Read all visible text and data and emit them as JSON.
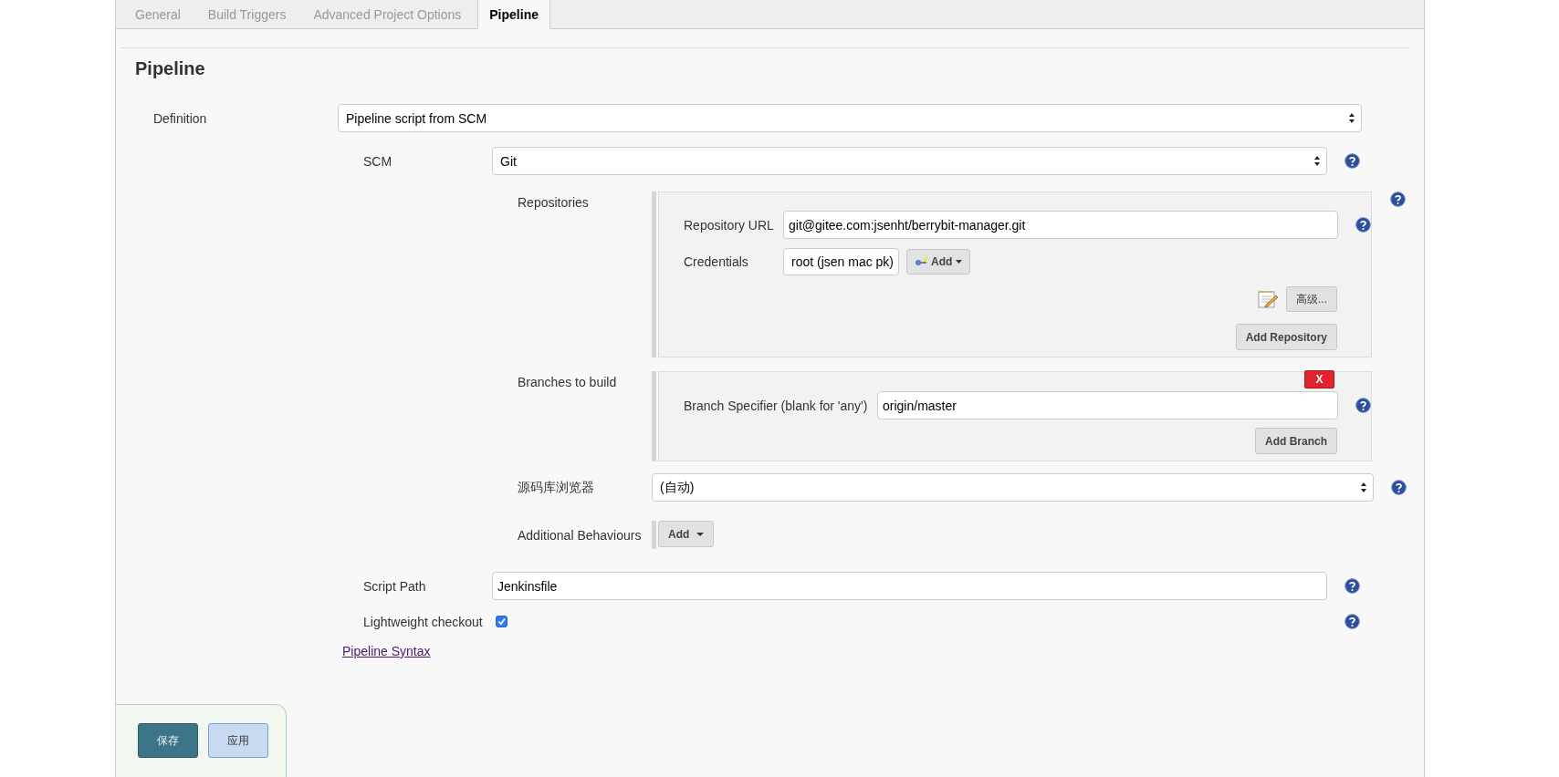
{
  "tabs": [
    {
      "label": "General",
      "selected": false
    },
    {
      "label": "Build Triggers",
      "selected": false
    },
    {
      "label": "Advanced Project Options",
      "selected": false
    },
    {
      "label": "Pipeline",
      "selected": true
    }
  ],
  "heading": "Pipeline",
  "definition": {
    "label": "Definition",
    "value": "Pipeline script from SCM"
  },
  "scm": {
    "label": "SCM",
    "value": "Git",
    "repositories": {
      "label": "Repositories",
      "url_label": "Repository URL",
      "url": "git@gitee.com:jsenht/berrybit-manager.git",
      "credentials_label": "Credentials",
      "credentials": "root (jsen mac pk)",
      "add_button": "Add",
      "advanced_button": "高级...",
      "add_repository_button": "Add Repository"
    },
    "branches": {
      "label": "Branches to build",
      "delete_button": "X",
      "specifier_label": "Branch Specifier (blank for 'any')",
      "specifier": "origin/master",
      "add_branch_button": "Add Branch"
    },
    "browser": {
      "label": "源码库浏览器",
      "value": "(自动)"
    },
    "behaviours": {
      "label": "Additional Behaviours",
      "add_button": "Add"
    }
  },
  "script_path": {
    "label": "Script Path",
    "value": "Jenkinsfile"
  },
  "lightweight": {
    "label": "Lightweight checkout",
    "checked": true
  },
  "syntax_link": "Pipeline Syntax",
  "buttons": [
    {
      "label": "保存",
      "kind": "primary"
    },
    {
      "label": "应用",
      "kind": "secondary"
    }
  ]
}
